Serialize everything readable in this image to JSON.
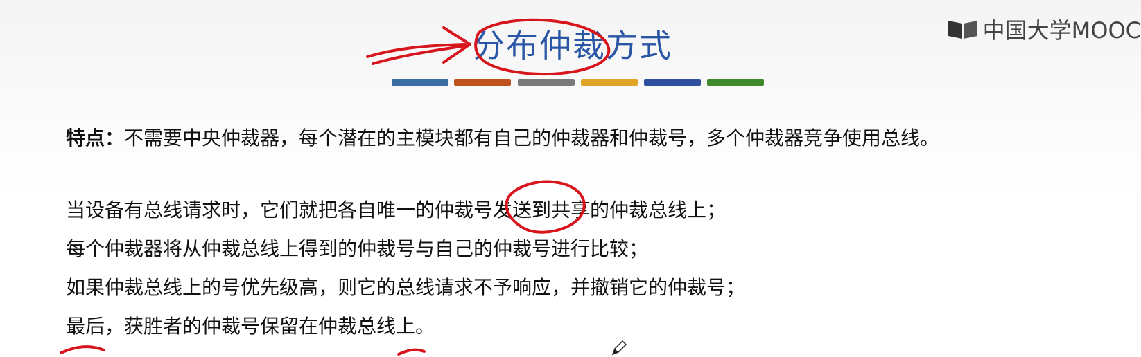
{
  "slide": {
    "title": "分布仲裁方式",
    "feature_label": "特点：",
    "feature_text": "不需要中央仲裁器，每个潜在的主模块都有自己的仲裁器和仲裁号，多个仲裁器竞争使用总线。",
    "lines": [
      "当设备有总线请求时，它们就把各自唯一的仲裁号发送到共享的仲裁总线上；",
      "每个仲裁器将从仲裁总线上得到的仲裁号与自己的仲裁号进行比较；",
      "如果仲裁总线上的号优先级高，则它的总线请求不予响应，并撤销它的仲裁号；",
      "最后，获胜者的仲裁号保留在仲裁总线上。"
    ],
    "title_bar_colors": [
      "#3a6ea5",
      "#c0521f",
      "#7a7a7a",
      "#e0a526",
      "#2d4f9e",
      "#3f8a2a"
    ]
  },
  "brand": {
    "text": "中国大学MOOC",
    "icon": "mooc-logo-icon"
  },
  "annotations": {
    "ink_color": "#d8141c",
    "arrow_icon": "hand-drawn-arrow-icon",
    "circle_icon": "hand-drawn-circle-icon",
    "cursor_icon": "pen-cursor-icon"
  }
}
